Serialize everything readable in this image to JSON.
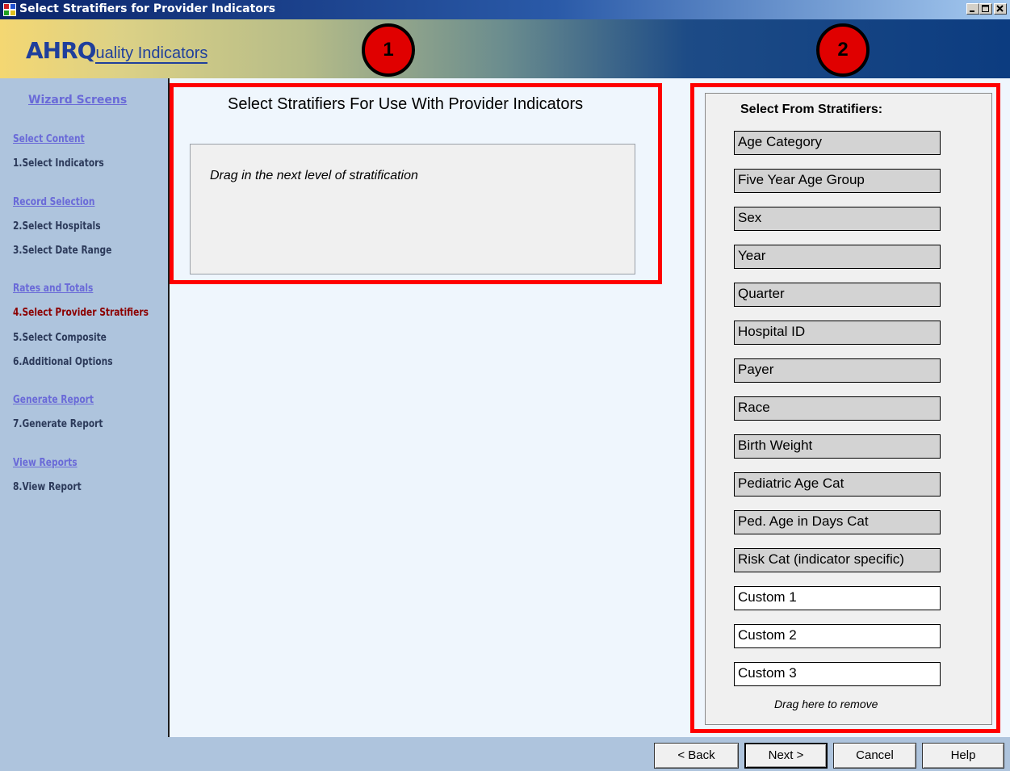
{
  "window": {
    "title": "Select Stratifiers for Provider Indicators",
    "minimize_icon": "minimize-icon",
    "maximize_icon": "maximize-icon",
    "close_icon": "close-icon"
  },
  "banner": {
    "logo_main": "AHRQ",
    "logo_sub": "uality Indicators",
    "callout_1": "1",
    "callout_2": "2",
    "callout_color": "#e00000"
  },
  "sidebar": {
    "title": "Wizard Screens",
    "sections": [
      {
        "label": "Select Content",
        "items": [
          "1.Select Indicators"
        ]
      },
      {
        "label": "Record Selection",
        "items": [
          "2.Select Hospitals",
          "3.Select Date Range"
        ]
      },
      {
        "label": "Rates and Totals",
        "items": [
          "4.Select Provider Stratifiers",
          "5.Select Composite",
          "6.Additional Options"
        ]
      },
      {
        "label": "Generate Report",
        "items": [
          "7.Generate Report"
        ]
      },
      {
        "label": "View Reports",
        "items": [
          "8.View Report"
        ]
      }
    ],
    "active_item": "4.Select Provider Stratifiers",
    "link_color": "#6a6ad8",
    "active_color": "#8c0000"
  },
  "main": {
    "title": "Select Stratifiers For Use With Provider Indicators",
    "drop_hint": "Drag in the next level of stratification",
    "highlight_color": "#ff0000"
  },
  "stratifiers": {
    "title": "Select From Stratifiers:",
    "items": [
      {
        "label": "Age Category",
        "style": "gray"
      },
      {
        "label": "Five Year Age Group",
        "style": "gray"
      },
      {
        "label": "Sex",
        "style": "gray"
      },
      {
        "label": "Year",
        "style": "gray"
      },
      {
        "label": "Quarter",
        "style": "gray"
      },
      {
        "label": "Hospital ID",
        "style": "gray"
      },
      {
        "label": "Payer",
        "style": "gray"
      },
      {
        "label": "Race",
        "style": "gray"
      },
      {
        "label": "Birth Weight",
        "style": "gray"
      },
      {
        "label": "Pediatric Age Cat",
        "style": "gray"
      },
      {
        "label": "Ped. Age in Days Cat",
        "style": "gray"
      },
      {
        "label": "Risk Cat (indicator specific)",
        "style": "gray"
      },
      {
        "label": "Custom 1",
        "style": "white"
      },
      {
        "label": "Custom 2",
        "style": "white"
      },
      {
        "label": "Custom 3",
        "style": "white"
      }
    ],
    "remove_hint": "Drag here to remove"
  },
  "footer": {
    "back": "< Back",
    "next": "Next >",
    "cancel": "Cancel",
    "help": "Help"
  }
}
